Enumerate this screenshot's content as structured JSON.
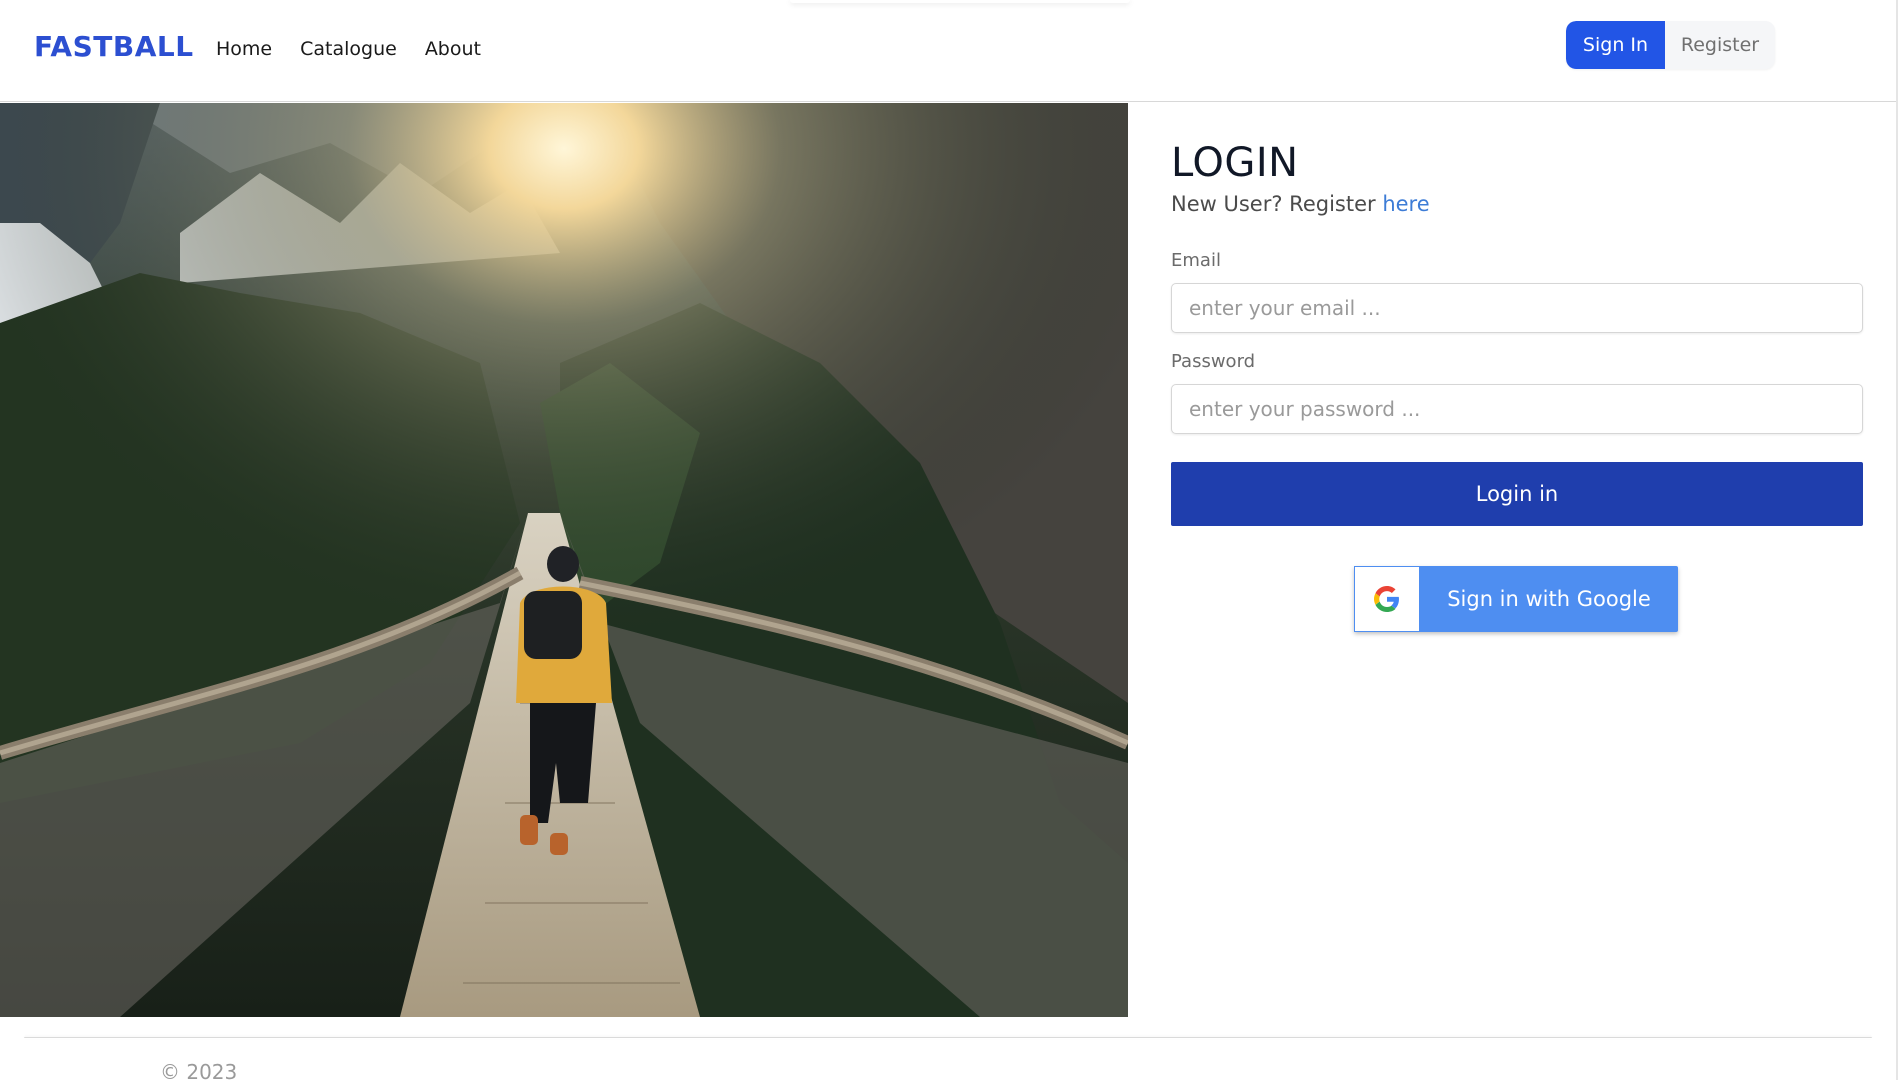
{
  "brand": {
    "name": "FASTBALL"
  },
  "nav": {
    "items": [
      {
        "label": "Home"
      },
      {
        "label": "Catalogue"
      },
      {
        "label": "About"
      }
    ]
  },
  "auth": {
    "signin_label": "Sign In",
    "register_label": "Register"
  },
  "login": {
    "title": "LOGIN",
    "subtitle_prefix": "New User? Register ",
    "subtitle_link": "here",
    "email_label": "Email",
    "email_placeholder": "enter your email ...",
    "password_label": "Password",
    "password_placeholder": "enter your password ...",
    "submit_label": "Login in",
    "google_label": "Sign in with Google"
  },
  "footer": {
    "copyright": "© 2023"
  },
  "colors": {
    "primary": "#2255e6",
    "login_button": "#1f3ead",
    "google_button": "#4e8ef1",
    "link": "#3d7cd6"
  }
}
